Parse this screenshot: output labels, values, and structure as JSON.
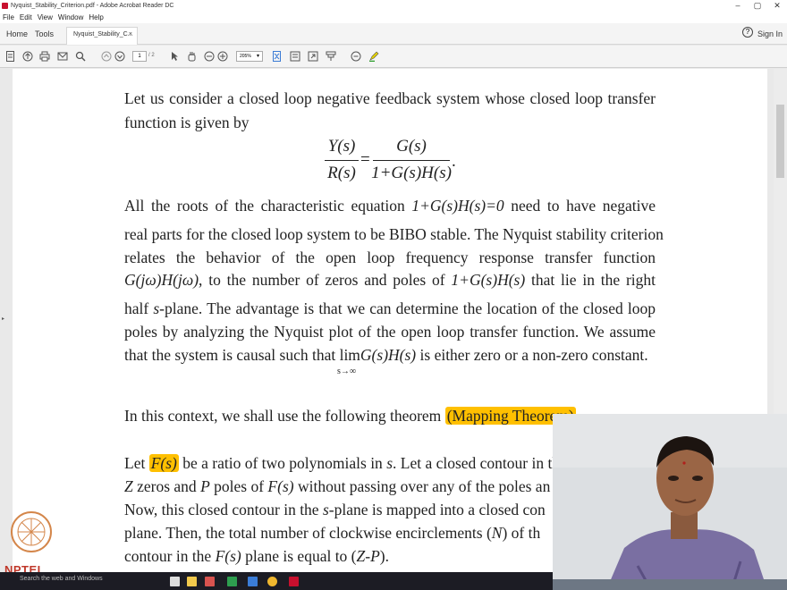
{
  "window": {
    "title": "Nyquist_Stability_Criterion.pdf - Adobe Acrobat Reader DC",
    "minimize": "–",
    "maximize": "▢",
    "close": "✕"
  },
  "menu": [
    "File",
    "Edit",
    "View",
    "Window",
    "Help"
  ],
  "tabs": {
    "home": "Home",
    "tools": "Tools",
    "document": "Nyquist_Stability_C...",
    "close": "×"
  },
  "account": {
    "help": "?",
    "signin": "Sign In"
  },
  "toolbar": {
    "page_current": "1",
    "page_total": "/ 2",
    "zoom": "205%"
  },
  "document": {
    "p1_l1": "Let us consider a closed loop negative feedback system whose closed loop transfer",
    "p1_l2": "function is given by",
    "eq_num_left": "Y(s)",
    "eq_den_left": "R(s)",
    "eq_equals": "=",
    "eq_num_right": "G(s)",
    "eq_den_right": "1+G(s)H(s)",
    "eq_dot": ".",
    "p2_l1a": "All the roots of the characteristic equation ",
    "p2_l1_eq": "1+G(s)H(s)=0",
    "p2_l1b": " need to have negative",
    "p2_l2": "real parts for the closed loop system to be BIBO stable. The Nyquist stability criterion",
    "p2_l3": "relates the behavior of the open loop frequency response transfer function",
    "p2_l4_eq": "G(jω)H(jω)",
    "p2_l4a": ", to the number of zeros and poles of ",
    "p2_l4_eq2": "1+G(s)H(s)",
    "p2_l4b": " that lie in the right",
    "p2_l5a": "half ",
    "p2_l5_s": "s",
    "p2_l5b": "-plane. The advantage is that we can determine the location of the closed loop",
    "p2_l6": "poles by analyzing the Nyquist plot of the open loop transfer function. We assume",
    "p2_l7a": "that the system is causal such that ",
    "p2_l7_lim": "lim",
    "p2_l7_eq": "G(s)H(s)",
    "p2_l7_sub": "s→∞",
    "p2_l7b": " is either zero or a non-zero constant.",
    "p3": "In this context, we shall use the following theorem ",
    "p3_hl": "(Mapping Theorem)",
    "p4_l1a": "Let ",
    "p4_l1_hl": "F(s)",
    "p4_l1b": " be a ratio of two polynomials in ",
    "p4_l1_s": "s",
    "p4_l1c": ". Let a closed contour in the",
    "p4_l2a": "Z",
    "p4_l2b": " zeros and ",
    "p4_l2c": "P",
    "p4_l2d": " poles of ",
    "p4_l2e": "F(s)",
    "p4_l2f": " without passing over any of the poles an",
    "p4_l3a": "Now, this closed contour in the ",
    "p4_l3_s": "s",
    "p4_l3b": "-plane is mapped into a closed con",
    "p4_l4a": "plane. Then, the total number of clockwise encirclements (",
    "p4_l4_n": "N",
    "p4_l4b": ") of th",
    "p4_l5a": "contour in the ",
    "p4_l5_f": "F(s)",
    "p4_l5b": " plane is equal to (",
    "p4_l5_zp": "Z-P",
    "p4_l5c": ")."
  },
  "taskbar": {
    "search": "Search the web and Windows"
  },
  "branding": {
    "nptel": "NPTEL"
  },
  "colors": {
    "highlight": "#ffc000",
    "acrobat_red": "#c8102e"
  }
}
